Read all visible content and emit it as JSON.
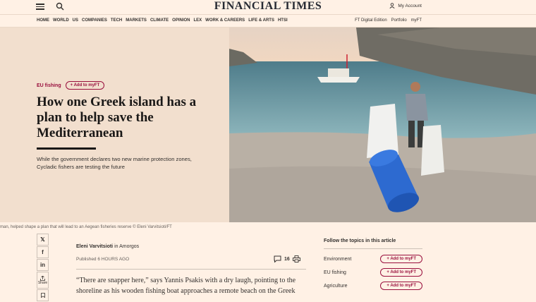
{
  "header": {
    "logo": "FINANCIAL TIMES",
    "account": "My Account"
  },
  "nav": {
    "left": [
      "HOME",
      "WORLD",
      "US",
      "COMPANIES",
      "TECH",
      "MARKETS",
      "CLIMATE",
      "OPINION",
      "LEX",
      "WORK & CAREERS",
      "LIFE & ARTS",
      "HTSI"
    ],
    "right": [
      "FT Digital Edition",
      "Portfolio",
      "myFT"
    ]
  },
  "article": {
    "tag": "EU fishing",
    "add_label": "+ Add to myFT",
    "headline": "How one Greek island has a plan to help save the Mediterranean",
    "standfirst": "While the government declares two new marine protection zones, Cycladic fishers are testing the future",
    "caption": "man, helped shape a plan that will lead to an Aegean fisheries reserve © Eleni Varvitsioti/FT",
    "author": "Eleni Varvitsioti",
    "location": " in Amorgos",
    "published": "Published 6 HOURS AGO",
    "comments": "16",
    "body": "“There are snapper here,” says Yannis Psakis with a dry laugh, pointing to the shoreline as his wooden fishing boat approaches a remote beach on the Greek"
  },
  "share": {
    "x": "𝕏",
    "facebook": "f",
    "linkedin": "in",
    "share_label": "Share"
  },
  "follow": {
    "title": "Follow the topics in this article",
    "topics": [
      {
        "name": "Environment",
        "btn": "+ Add to myFT"
      },
      {
        "name": "EU fishing",
        "btn": "+ Add to myFT"
      },
      {
        "name": "Agriculture",
        "btn": "+ Add to myFT"
      }
    ]
  }
}
